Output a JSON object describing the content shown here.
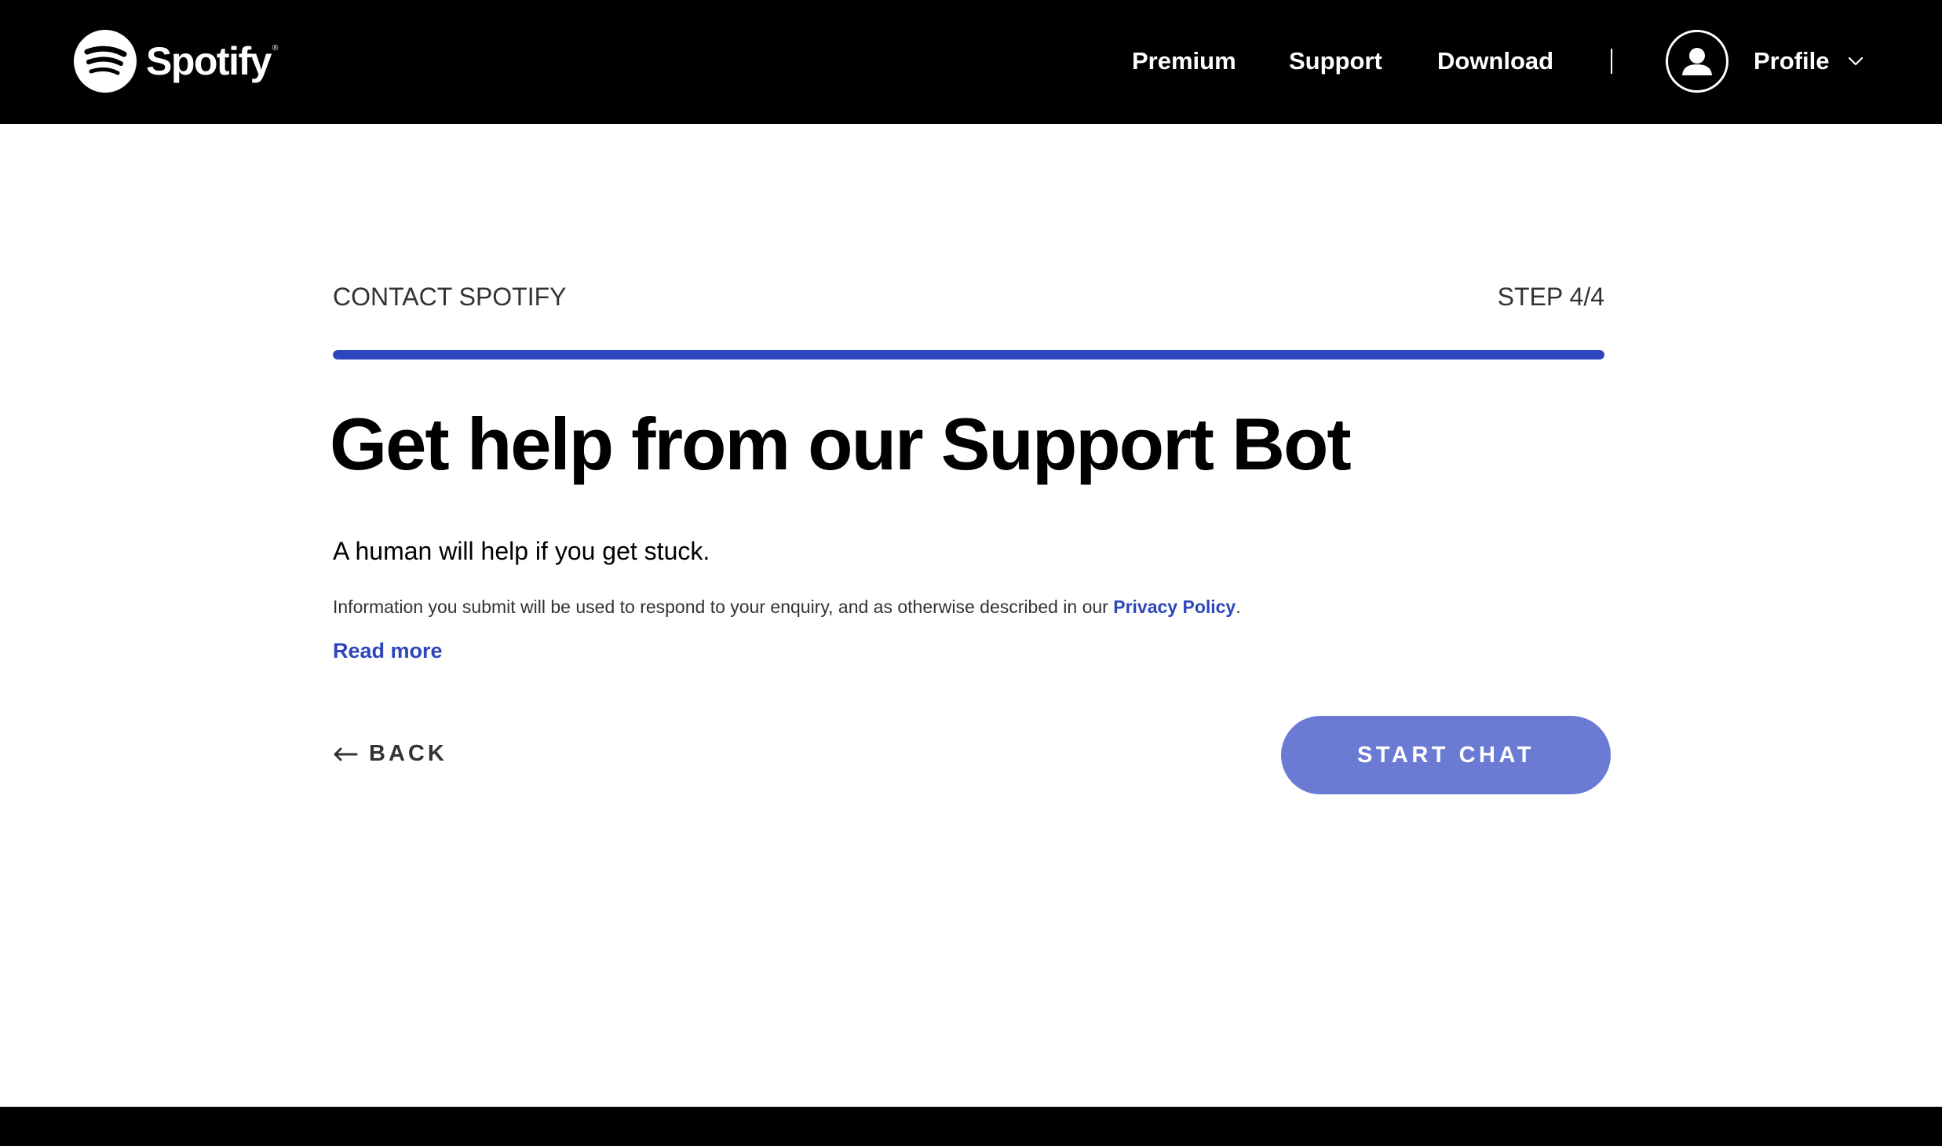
{
  "header": {
    "logo_text": "Spotify",
    "logo_trademark": "®",
    "nav": [
      {
        "label": "Premium"
      },
      {
        "label": "Support"
      },
      {
        "label": "Download"
      }
    ],
    "profile_label": "Profile"
  },
  "main": {
    "section_label": "CONTACT SPOTIFY",
    "step_label": "STEP 4/4",
    "progress": 1.0,
    "title": "Get help from our Support Bot",
    "subtitle": "A human will help if you get stuck.",
    "info_text": "Information you submit will be used to respond to your enquiry, and as otherwise described in our ",
    "privacy_link": "Privacy Policy",
    "info_end": ".",
    "read_more": "Read more",
    "back_label": "BACK",
    "start_chat_label": "START CHAT"
  },
  "colors": {
    "accent": "#2d46c0",
    "link": "#2d46b9",
    "button": "#6b7bd3",
    "header_bg": "#000000"
  },
  "icons": {
    "logo": "spotify-logo-icon",
    "avatar": "user-icon",
    "chevron": "chevron-down-icon",
    "back": "arrow-left-icon"
  }
}
